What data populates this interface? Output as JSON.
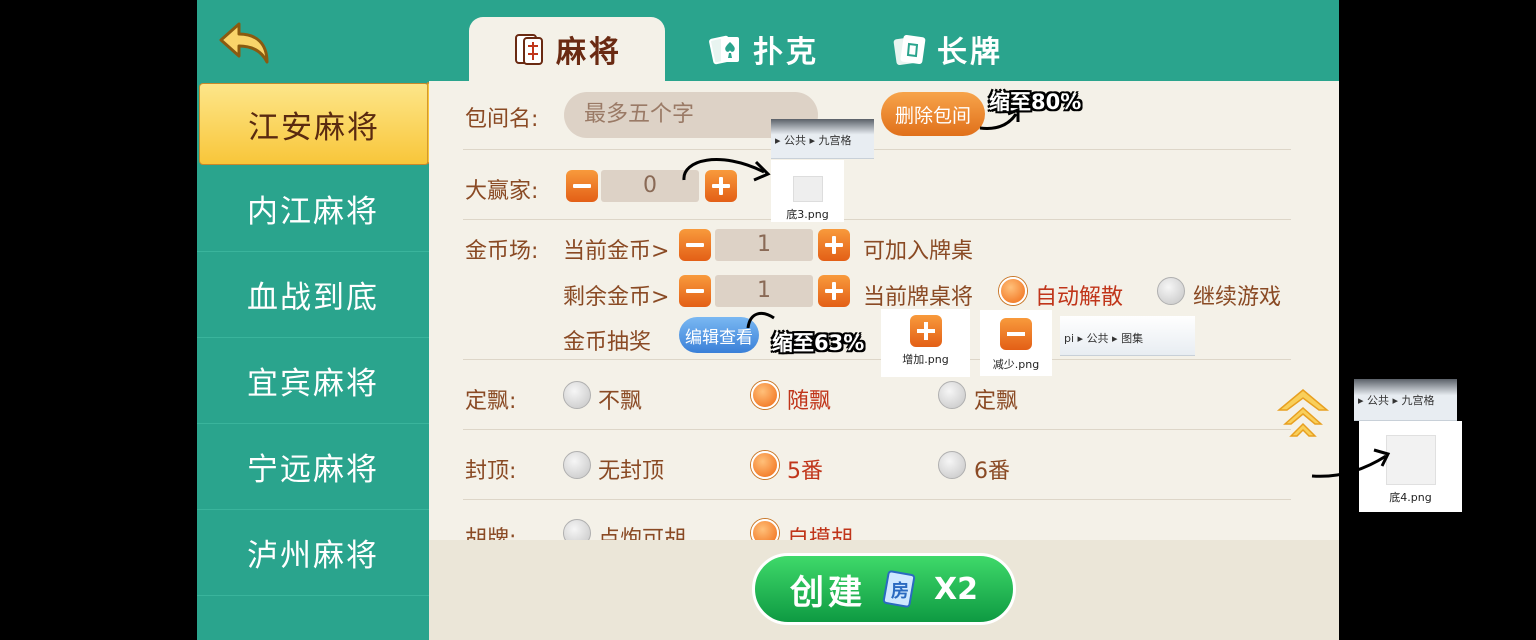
{
  "tabs": [
    {
      "label": "麻将",
      "icon": "mahjong-tile-icon",
      "active": true
    },
    {
      "label": "扑克",
      "icon": "poker-cards-icon",
      "active": false
    },
    {
      "label": "长牌",
      "icon": "long-cards-icon",
      "active": false
    }
  ],
  "sidebar": {
    "items": [
      {
        "label": "江安麻将",
        "active": true
      },
      {
        "label": "内江麻将"
      },
      {
        "label": "血战到底"
      },
      {
        "label": "宜宾麻将"
      },
      {
        "label": "宁远麻将"
      },
      {
        "label": "泸州麻将"
      }
    ]
  },
  "form": {
    "room_name": {
      "label": "包间名:",
      "placeholder": "最多五个字"
    },
    "delete_room_label": "删除包间",
    "big_winner": {
      "label": "大赢家:",
      "value": "0"
    },
    "coin_field": {
      "label": "金币场:",
      "current_label": "当前金币>",
      "current_value": "1",
      "current_suffix": "可加入牌桌",
      "remaining_label": "剩余金币>",
      "remaining_value": "1",
      "remaining_suffix": "当前牌桌将",
      "auto_dissolve": "自动解散",
      "continue_game": "继续游戏",
      "lottery_label": "金币抽奖",
      "edit_view_label": "编辑查看"
    },
    "piao": {
      "label": "定飘:",
      "options": [
        "不飘",
        "随飘",
        "定飘"
      ],
      "selected": 1
    },
    "cap": {
      "label": "封顶:",
      "options": [
        "无封顶",
        "5番",
        "6番"
      ],
      "selected": 1
    },
    "hu": {
      "label": "胡牌:",
      "options": [
        "点炮可胡",
        "自摸胡"
      ],
      "selected": 1
    }
  },
  "create": {
    "label": "创建",
    "icon": "room-card-icon",
    "card_glyph": "房",
    "count": "X2"
  },
  "annotations": {
    "note_80": "缩至80%",
    "note_63": "缩至63%",
    "breadcrumb_1": [
      "公共",
      "九宫格"
    ],
    "breadcrumb_2": [
      "pi",
      "公共",
      "图集"
    ],
    "breadcrumb_3": [
      "公共",
      "九宫格"
    ],
    "file_di3": "底3.png",
    "file_add": "增加.png",
    "file_reduce": "减少.png",
    "file_di4": "底4.png"
  },
  "colors": {
    "teal": "#2aa48d",
    "panel": "#f4f1e8",
    "accent_orange": "#f06a14",
    "selected_text": "#c0351a",
    "create_green": "#0e9a42"
  }
}
